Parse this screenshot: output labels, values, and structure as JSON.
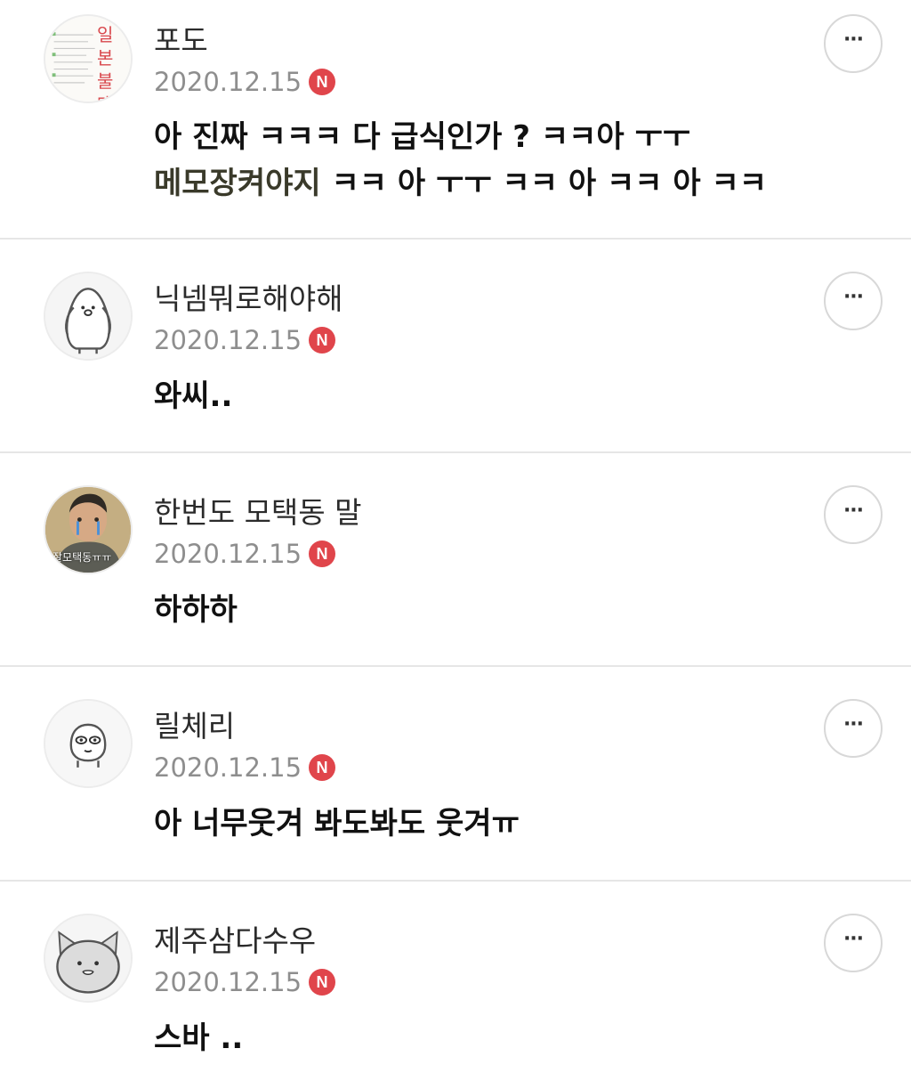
{
  "colors": {
    "badge": "#e0454b",
    "divider": "#e6e6e6",
    "date": "#8e8e8e",
    "highlight": "#f8f3a8"
  },
  "comments": [
    {
      "nickname": "포도",
      "date": "2020.12.15",
      "badge": "N",
      "avatar_icon": "profile-image-icon",
      "avatar_handwriting": "일본 불매",
      "lines": [
        "아 진짜 ㅋㅋㅋ 다 급식인가 ? ㅋㅋ아 ㅜㅜ",
        "메모장켜야지",
        " ㅋㅋ 아 ㅜㅜ ㅋㅋ 아 ㅋㅋ 아 ㅋㅋ"
      ],
      "more_icon": "more-icon",
      "more_label": "···"
    },
    {
      "nickname": "닉넴뭐로해야해",
      "date": "2020.12.15",
      "badge": "N",
      "avatar_icon": "penguin-icon",
      "text": "와씨..",
      "more_label": "···"
    },
    {
      "nickname": "한번도 모택동 말",
      "date": "2020.12.15",
      "badge": "N",
      "avatar_icon": "portrait-icon",
      "avatar_caption": "잘모택동ㅠㅠ",
      "text": "하하하",
      "more_label": "···"
    },
    {
      "nickname": "릴체리",
      "date": "2020.12.15",
      "badge": "N",
      "avatar_icon": "character-icon",
      "text": "아 너무웃겨 봐도봐도 웃겨ㅠ",
      "more_label": "···"
    },
    {
      "nickname": "제주삼다수우",
      "date": "2020.12.15",
      "badge": "N",
      "avatar_icon": "cat-icon",
      "text": "스바 ..",
      "more_label": "···"
    }
  ]
}
